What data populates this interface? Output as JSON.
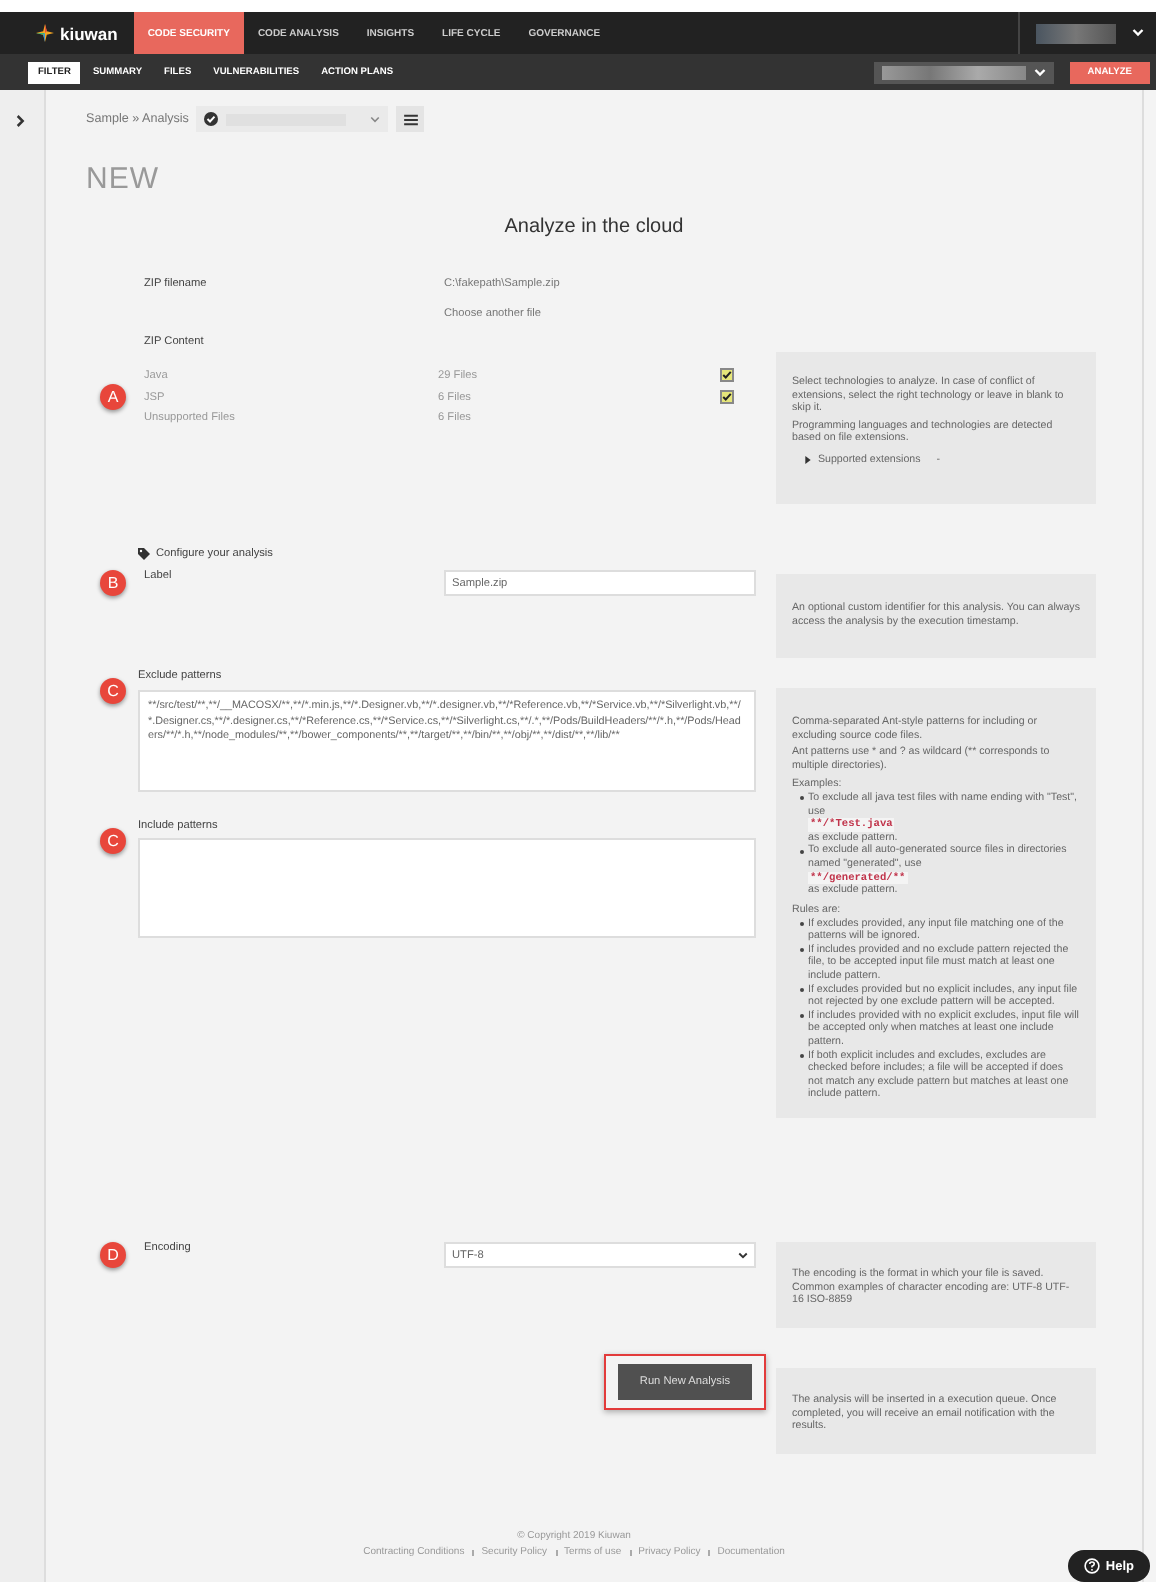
{
  "nav": {
    "logo": "kiuwan",
    "tabs": [
      {
        "label": "CODE SECURITY",
        "selected": true
      },
      {
        "label": "CODE ANALYSIS",
        "selected": false
      },
      {
        "label": "INSIGHTS",
        "selected": false
      },
      {
        "label": "LIFE CYCLE",
        "selected": false
      },
      {
        "label": "GOVERNANCE",
        "selected": false
      }
    ]
  },
  "subnav": {
    "tabs": [
      {
        "label": "FILTER",
        "selected": true
      },
      {
        "label": "SUMMARY",
        "selected": false
      },
      {
        "label": "FILES",
        "selected": false
      },
      {
        "label": "VULNERABILITIES",
        "selected": false
      },
      {
        "label": "ACTION PLANS",
        "selected": false
      }
    ],
    "analyze_button": "ANALYZE"
  },
  "breadcrumb": "Sample » Analysis",
  "heading": "NEW",
  "title": "Analyze in the cloud",
  "zip": {
    "filename_label": "ZIP filename",
    "filename": "C:\\fakepath\\Sample.zip",
    "choose_link": "Choose another file",
    "content_label": "ZIP Content",
    "marker": "A",
    "rows": [
      {
        "kind": "technology",
        "name": "Java",
        "files": "29 Files",
        "checked": true
      },
      {
        "kind": "technology",
        "name": "JSP",
        "files": "6 Files",
        "checked": true
      },
      {
        "kind": "unsupported",
        "name": "Unsupported Files",
        "files": "6 Files"
      }
    ],
    "help": {
      "paragraphs": [
        "Select technologies to analyze. In case of conflict of extensions, select the right technology or leave in blank to skip it.",
        "Programming languages and technologies are detected based on file extensions."
      ],
      "toggle": "Supported extensions",
      "toggle_value": "-",
      "expanded": false
    }
  },
  "configure_heading": "Configure your analysis",
  "label_field": {
    "marker": "B",
    "label": "Label",
    "value": "Sample.zip",
    "help": "An optional custom identifier for this analysis. You can always access the analysis by the execution timestamp."
  },
  "exclude": {
    "marker": "C",
    "label": "Exclude patterns",
    "value": "**/src/test/**,**/__MACOSX/**,**/*.min.js,**/*.Designer.vb,**/*.designer.vb,**/*Reference.vb,**/*Service.vb,**/*Silverlight.vb,**/*.Designer.cs,**/*.designer.cs,**/*Reference.cs,**/*Service.cs,**/*Silverlight.cs,**/.*,**/Pods/BuildHeaders/**/*.h,**/Pods/Headers/**/*.h,**/node_modules/**,**/bower_components/**,**/target/**,**/bin/**,**/obj/**,**/dist/**,**/lib/**"
  },
  "include": {
    "marker": "C",
    "label": "Include patterns"
  },
  "patterns_help": {
    "paragraphs": [
      "Comma-separated Ant-style patterns for including or excluding source code files.",
      "Ant patterns use * and ? as wildcard (** corresponds to multiple directories)."
    ],
    "examples_label": "Examples:",
    "examples": [
      {
        "text": "To exclude all java test files with name ending with \"Test\", use",
        "code": "**/*Test.java",
        "after": "as exclude pattern."
      },
      {
        "text": "To exclude all auto-generated source files in directories named \"generated\", use",
        "code": "**/generated/**",
        "after": "as exclude pattern."
      }
    ],
    "rules_label": "Rules are:",
    "rules": [
      "If excludes provided, any input file matching one of the patterns will be ignored.",
      "If includes provided and no exclude pattern rejected the file, to be accepted input file must match at least one include pattern.",
      "If excludes provided but no explicit includes, any input file not rejected by one exclude pattern will be accepted.",
      "If includes provided with no explicit excludes, input file will be accepted only when matches at least one include pattern.",
      "If both explicit includes and excludes, excludes are checked before includes; a file will be accepted if does not match any exclude pattern but matches at least one include pattern."
    ]
  },
  "encoding": {
    "marker": "D",
    "label": "Encoding",
    "value": "UTF-8",
    "help": "The encoding is the format in which your file is saved. Common examples of character encoding are: UTF-8 UTF-16 ISO-8859"
  },
  "run": {
    "button": "Run New Analysis",
    "highlighted": true,
    "help": "The analysis will be inserted in a execution queue. Once completed, you will receive an email notification with the results."
  },
  "footer": {
    "copyright": "© Copyright 2019 Kiuwan",
    "links": [
      "Contracting Conditions",
      "Security Policy",
      "Terms of use",
      "Privacy Policy",
      "Documentation"
    ]
  },
  "help_button": "Help"
}
